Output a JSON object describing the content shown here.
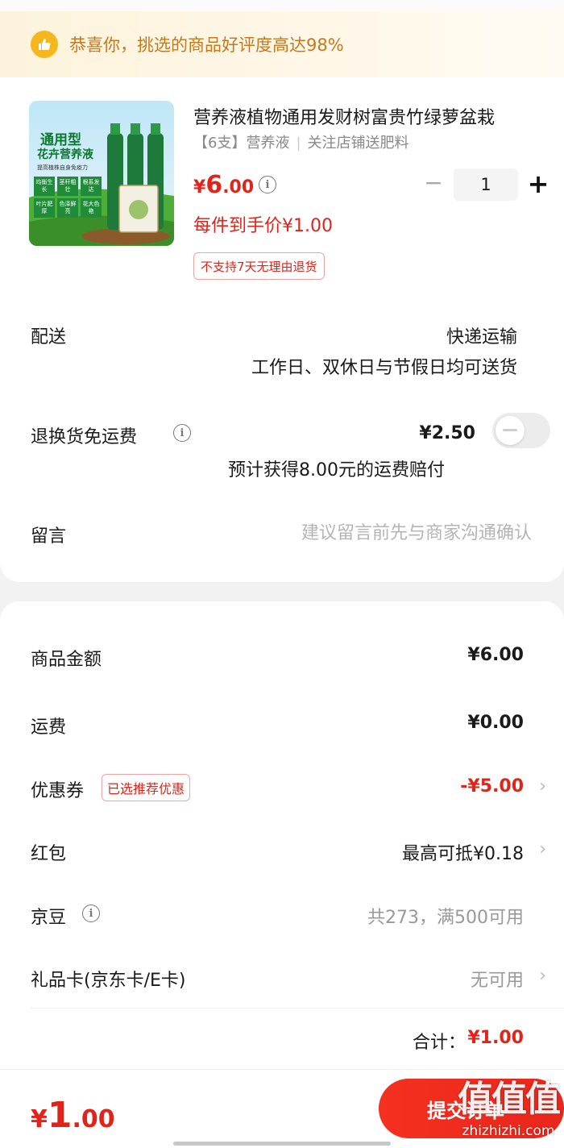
{
  "banner": {
    "text": "恭喜你，挑选的商品好评度高达98%",
    "icon": "thumbs-up-icon"
  },
  "product": {
    "title": "营养液植物通用发财树富贵竹绿萝盆栽",
    "spec": "【6支】营养液",
    "shop_note": "关注店铺送肥料",
    "price_yen": "¥",
    "price_int": "6",
    "price_dec": ".00",
    "per_item_price": "每件到手价¥1.00",
    "return_policy": "不支持7天无理由退货",
    "quantity": "1",
    "minus": "−",
    "plus": "+",
    "image_text": {
      "title": "通用型",
      "subtitle": "花卉营养液",
      "line": "提高植株自身免疫力",
      "cells": [
        "均衡生长",
        "茎秆粗壮",
        "根系发达",
        "叶片肥厚",
        "色泽鲜亮",
        "花大色艳"
      ]
    }
  },
  "delivery": {
    "label": "配送",
    "method": "快递运输",
    "note": "工作日、双休日与节假日均可送货"
  },
  "return_shipping": {
    "label": "退换货免运费",
    "price": "¥2.50",
    "note": "预计获得8.00元的运费赔付",
    "enabled": false
  },
  "message": {
    "label": "留言",
    "placeholder": "建议留言前先与商家沟通确认"
  },
  "summary": {
    "goods_label": "商品金额",
    "goods_amount": "¥6.00",
    "freight_label": "运费",
    "freight_amount": "¥0.00",
    "coupon_label": "优惠券",
    "coupon_tag": "已选推荐优惠",
    "coupon_amount": "-¥5.00",
    "redpacket_label": "红包",
    "redpacket_value": "最高可抵¥0.18",
    "jd_bean_label": "京豆",
    "jd_bean_value": "共273，满500可用",
    "giftcard_label": "礼品卡(京东卡/E卡)",
    "giftcard_value": "无可用",
    "total_label": "合计：",
    "total_amount": "¥1.00",
    "chevron": "›"
  },
  "bottom": {
    "price_yen": "¥",
    "price_int": "1",
    "price_dec": ".00",
    "submit_label": "提交订单",
    "watermark": "值值值",
    "watermark_url": "zhizhizhi.com"
  },
  "colors": {
    "accent": "#e2231a",
    "banner_text": "#c8781a",
    "banner_bg": "#fdf3dc"
  }
}
